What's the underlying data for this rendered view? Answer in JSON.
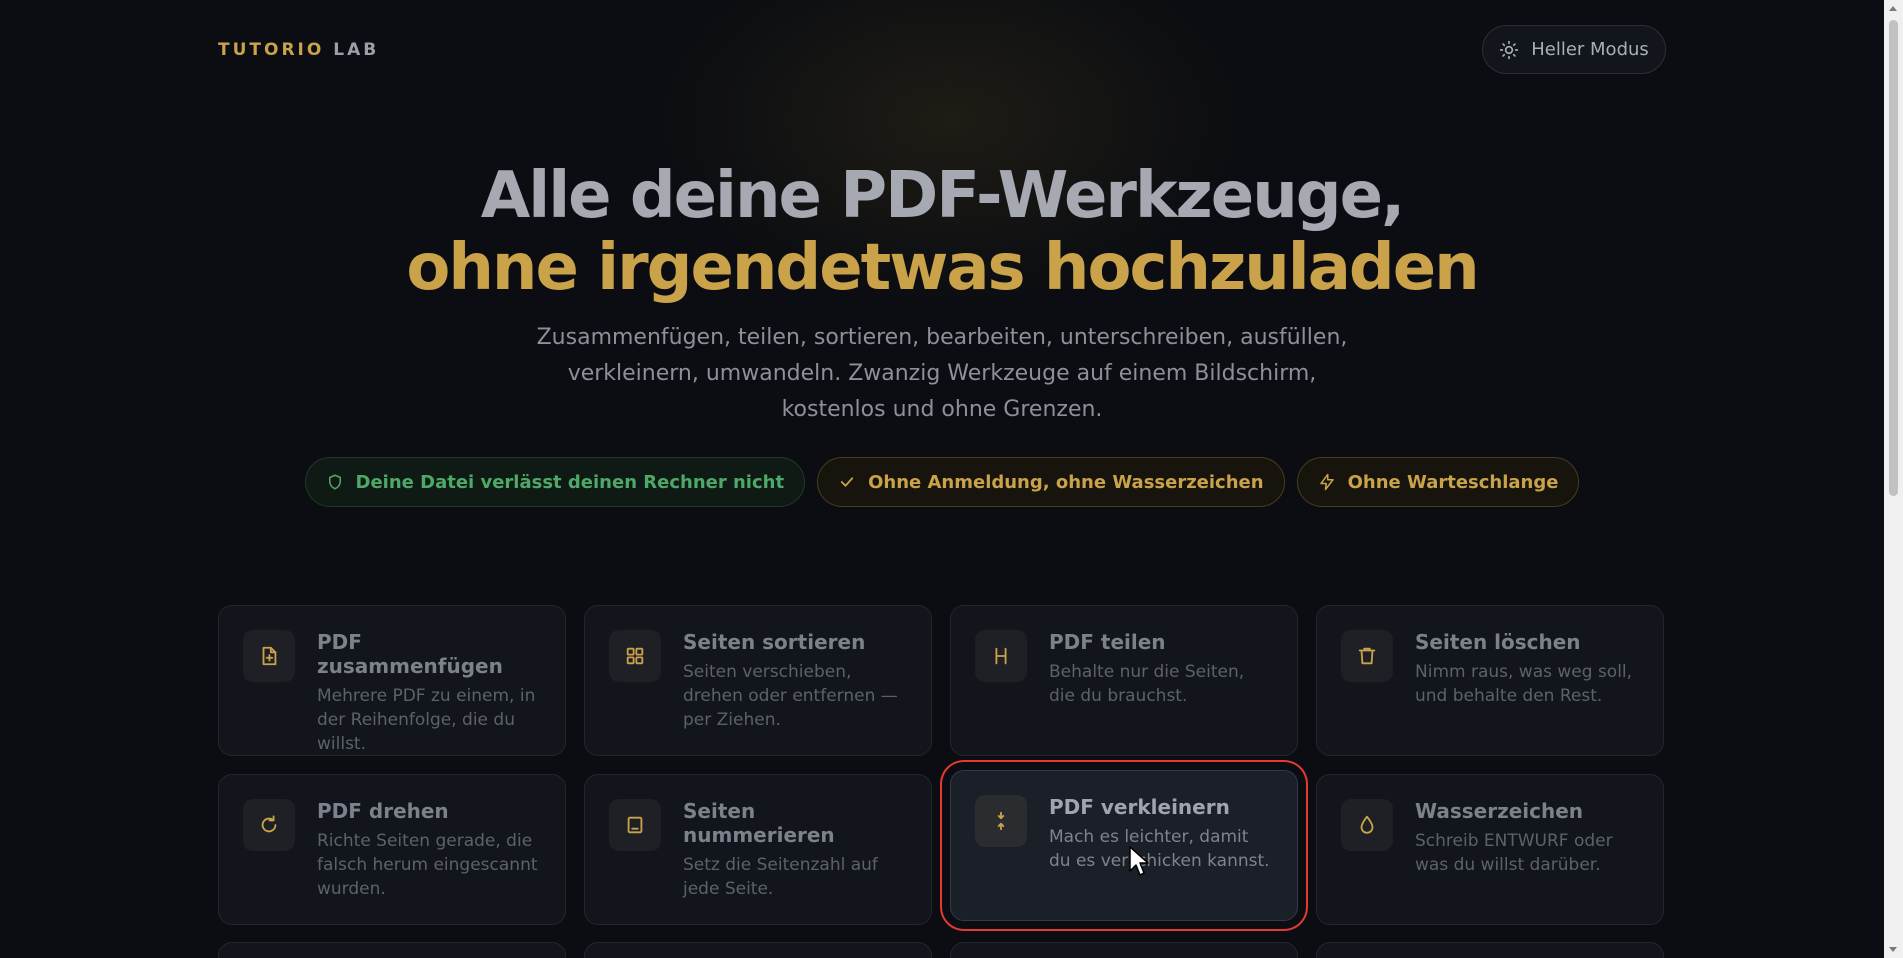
{
  "header": {
    "logo_part1": "TUTORIO",
    "logo_part2": "LAB",
    "mode_button": "Heller Modus"
  },
  "hero": {
    "title_line1": "Alle deine PDF-Werkzeuge,",
    "title_line2": "ohne irgendetwas hochzuladen",
    "subtitle": "Zusammenfügen, teilen, sortieren, bearbeiten, unterschreiben, ausfüllen, verkleinern, umwandeln. Zwanzig Werkzeuge auf einem Bildschirm, kostenlos und ohne Grenzen."
  },
  "badges": [
    {
      "label": "Deine Datei verlässt deinen Rechner nicht",
      "icon": "shield-icon"
    },
    {
      "label": "Ohne Anmeldung, ohne Wasserzeichen",
      "icon": "check-icon"
    },
    {
      "label": "Ohne Warteschlange",
      "icon": "bolt-icon"
    }
  ],
  "tools": [
    {
      "name": "PDF zusammenfügen",
      "desc": "Mehrere PDF zu einem, in der Reihenfolge, die du willst.",
      "icon": "file-plus-icon"
    },
    {
      "name": "Seiten sortieren",
      "desc": "Seiten verschieben, drehen oder entfernen — per Ziehen.",
      "icon": "grid-icon"
    },
    {
      "name": "PDF teilen",
      "desc": "Behalte nur die Seiten, die du brauchst.",
      "icon": "split-icon"
    },
    {
      "name": "Seiten löschen",
      "desc": "Nimm raus, was weg soll, und behalte den Rest.",
      "icon": "trash-icon"
    },
    {
      "name": "PDF drehen",
      "desc": "Richte Seiten gerade, die falsch herum eingescannt wurden.",
      "icon": "rotate-icon"
    },
    {
      "name": "Seiten nummerieren",
      "desc": "Setz die Seitenzahl auf jede Seite.",
      "icon": "page-number-icon"
    },
    {
      "name": "PDF verkleinern",
      "desc": "Mach es leichter, damit du es verschicken kannst.",
      "icon": "compress-icon"
    },
    {
      "name": "Wasserzeichen",
      "desc": "Schreib ENTWURF oder was du willst darüber.",
      "icon": "droplet-icon"
    }
  ],
  "colors": {
    "accent_gold": "#c9a24a",
    "green": "#4ea868",
    "background": "#0b0d12",
    "highlight_red": "#e43a33"
  }
}
